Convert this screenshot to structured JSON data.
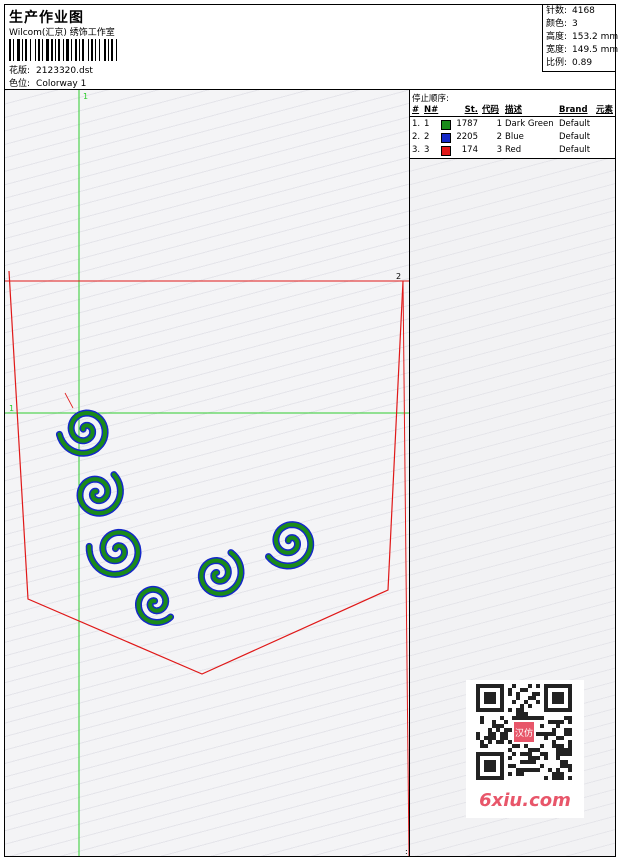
{
  "header": {
    "title": "生产作业图",
    "company": "Wilcom(汇京) 绣饰工作室",
    "design_label": "花版:",
    "design_value": "2123320.dst",
    "colorway_label": "色位:",
    "colorway_value": "Colorway 1"
  },
  "stats": {
    "stitches_label": "针数:",
    "stitches_value": "4168",
    "colors_label": "颜色:",
    "colors_value": "3",
    "height_label": "高度:",
    "height_value": "153.2 mm",
    "width_label": "宽度:",
    "width_value": "149.5 mm",
    "scale_label": "比例:",
    "scale_value": "0.89"
  },
  "design_markers": {
    "top": "1",
    "right": "2",
    "left": "1",
    "bottom_right": ":"
  },
  "stop_sequence": {
    "title": "停止顺序:",
    "headers": {
      "idx": "#",
      "no": "N#",
      "st": "St.",
      "code": "代码",
      "desc": "描述",
      "brand": "Brand",
      "element": "元素"
    },
    "rows": [
      {
        "idx": "1.",
        "no": "1",
        "color": "#1a8a1a",
        "st": "1787",
        "code": "1",
        "desc": "Dark Green",
        "brand": "Default"
      },
      {
        "idx": "2.",
        "no": "2",
        "color": "#1428c8",
        "st": "2205",
        "code": "2",
        "desc": "Blue",
        "brand": "Default"
      },
      {
        "idx": "3.",
        "no": "3",
        "color": "#e01818",
        "st": "174",
        "code": "3",
        "desc": "Red",
        "brand": "Default"
      }
    ]
  },
  "watermark": {
    "text": "6xiu.com",
    "stamp": "汉仿"
  },
  "colors": {
    "guide": "#2ecc2e",
    "outline": "#e01818",
    "fill_green": "#1a8a1a",
    "fill_blue": "#1428c8"
  }
}
